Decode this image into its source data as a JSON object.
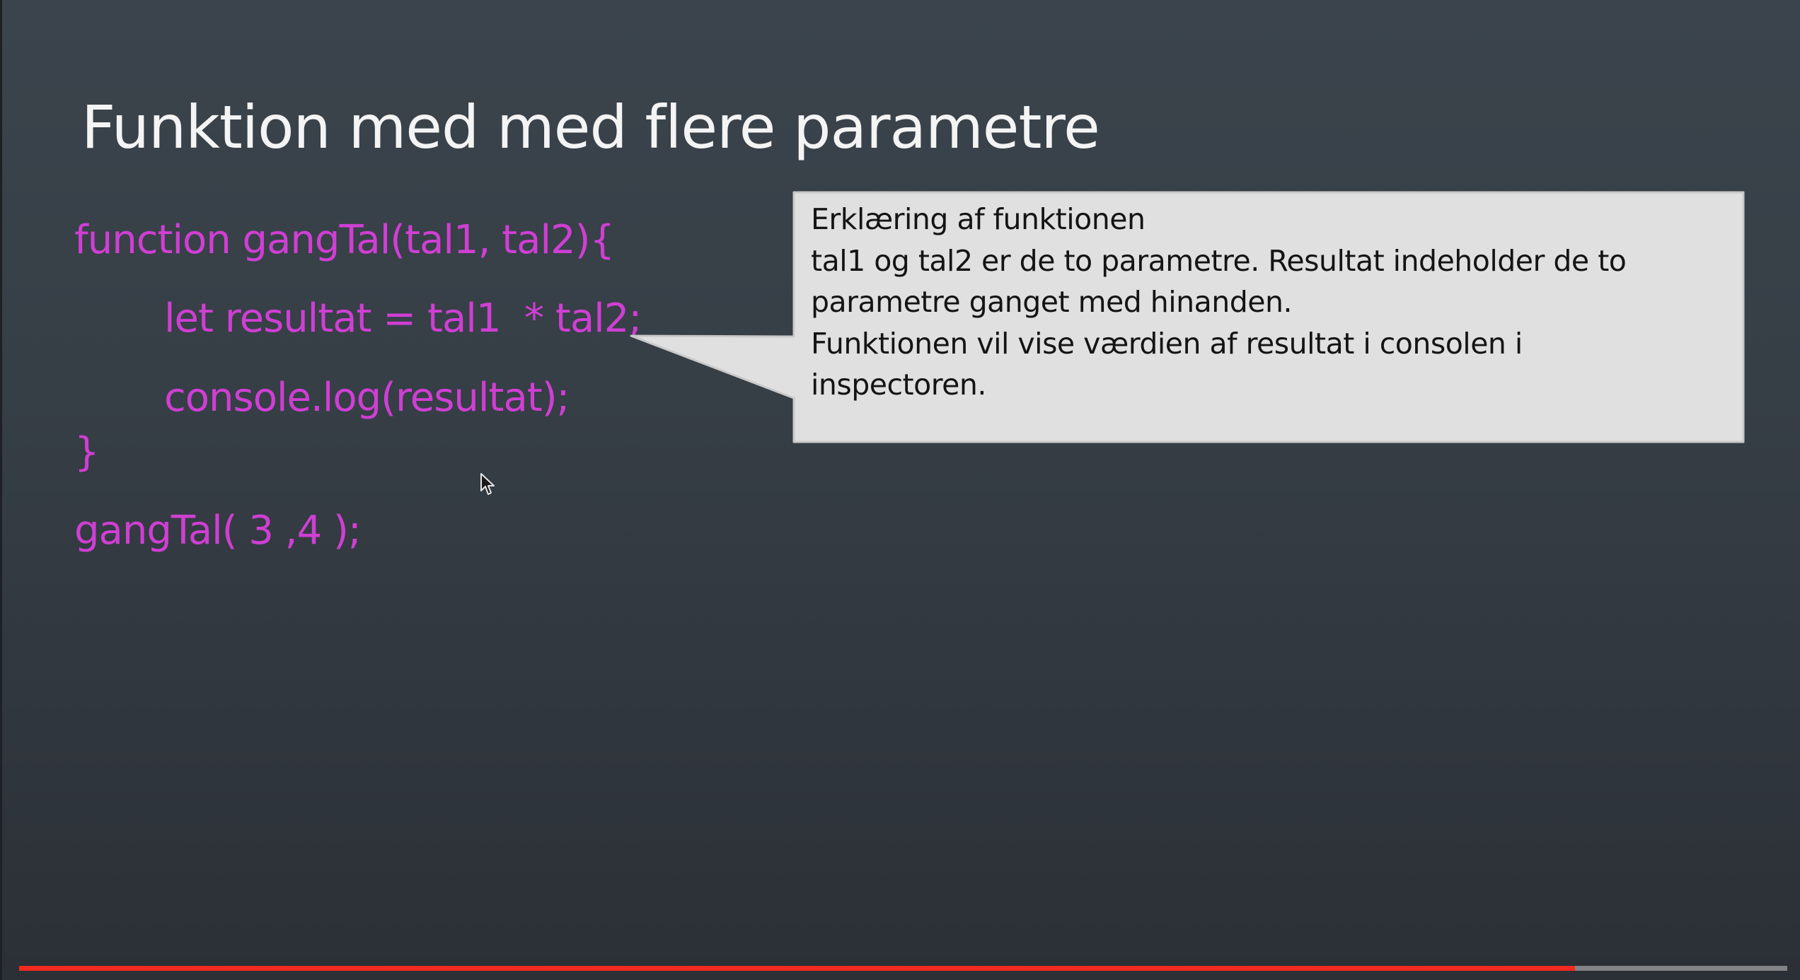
{
  "slide": {
    "title": "Funktion med med flere parametre",
    "code_lines": [
      "function gangTal(tal1, tal2){",
      "let resultat = tal1  * tal2;",
      "console.log(resultat);",
      "}",
      "gangTal( 3 ,4 );"
    ],
    "callout_lines": [
      "Erklæring af funktionen",
      "tal1 og tal2 er de to parametre. Resultat indeholder de to",
      "parametre ganget med hinanden.",
      "Funktionen vil vise værdien af resultat  i consolen i",
      "inspectoren."
    ]
  },
  "player": {
    "progress_fraction": 0.88
  },
  "icons": {
    "cursor": "mouse-pointer-icon"
  },
  "colors": {
    "code": "#cf3fd3",
    "progress": "#f22a1f",
    "callout_bg": "#e0e0e0"
  }
}
